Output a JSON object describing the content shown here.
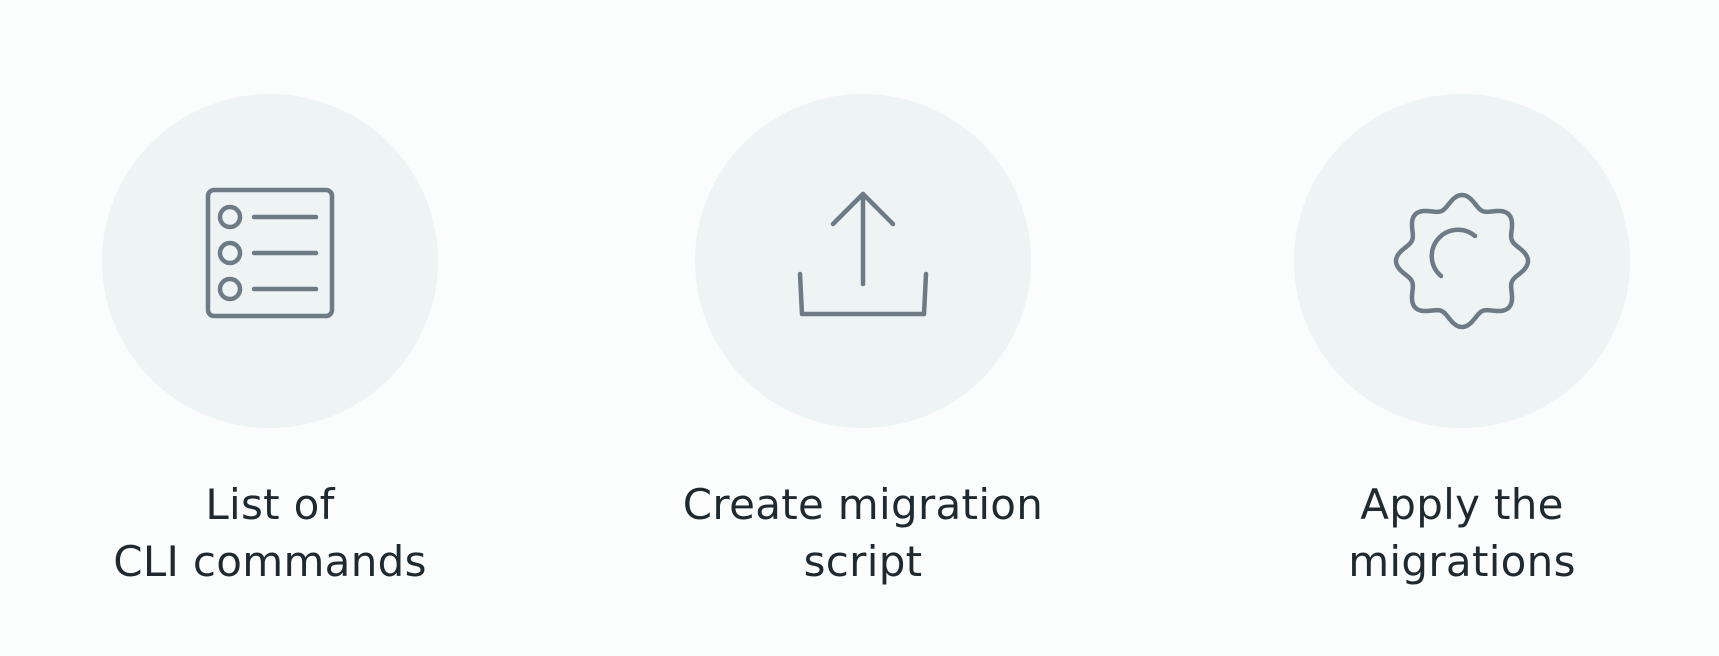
{
  "colors": {
    "background": "#fbfcfc",
    "circle_fill": "#eef3f4",
    "icon_stroke": "#6d7b87",
    "text": "#1f2a30"
  },
  "steps": [
    {
      "icon": "list-icon",
      "label_line_1": "List of",
      "label_line_2": "CLI commands"
    },
    {
      "icon": "upload-icon",
      "label_line_1": "Create migration",
      "label_line_2": "script"
    },
    {
      "icon": "gear-icon",
      "label_line_1": "Apply the",
      "label_line_2": "migrations"
    }
  ]
}
